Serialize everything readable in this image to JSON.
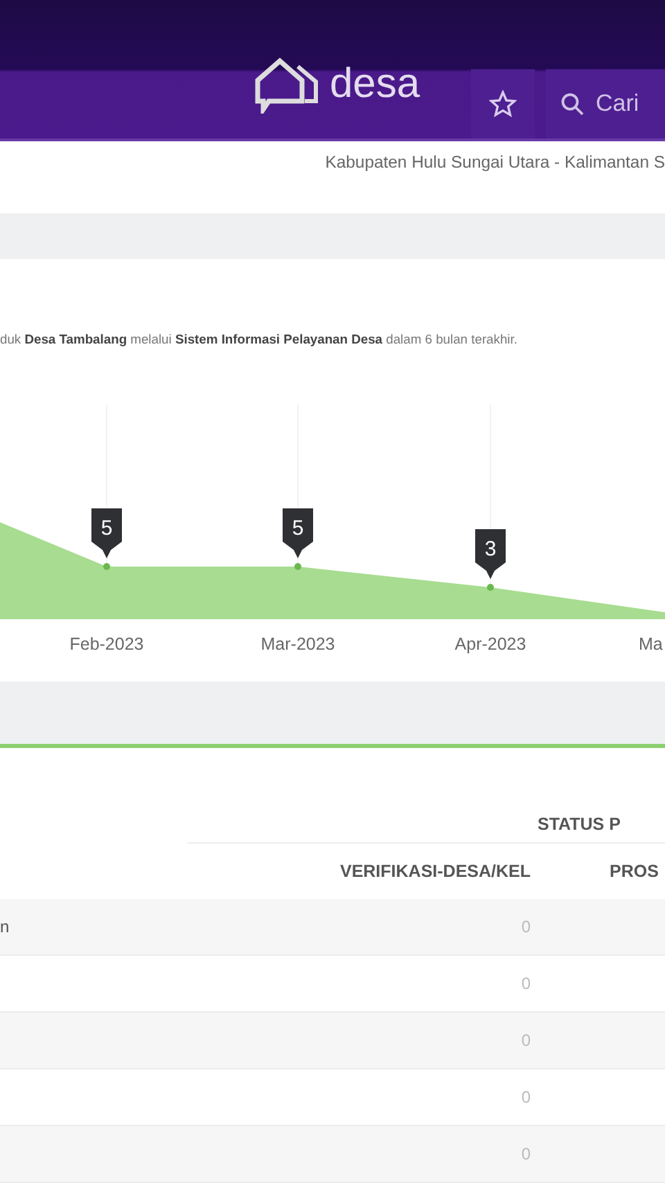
{
  "header": {
    "logo_text": "desa",
    "search_label": "Cari"
  },
  "location": "Kabupaten Hulu Sungai Utara - Kalimantan S",
  "description": "duk **Desa Tambalang** melalui **Sistem Informasi Pelayanan Desa** dalam 6 bulan terakhir.",
  "chart": {
    "labels": [
      "5",
      "5",
      "3"
    ],
    "categories": [
      "Feb-2023",
      "Mar-2023",
      "Apr-2023",
      "Ma"
    ]
  },
  "table": {
    "group_header": "STATUS P",
    "columns": [
      "VERIFIKASI-DESA/KEL",
      "PROS"
    ],
    "rows": [
      {
        "label": "n",
        "verifikasi": "0"
      },
      {
        "verifikasi": "0"
      },
      {
        "verifikasi": "0"
      },
      {
        "verifikasi": "0"
      },
      {
        "verifikasi": "0"
      }
    ]
  }
}
